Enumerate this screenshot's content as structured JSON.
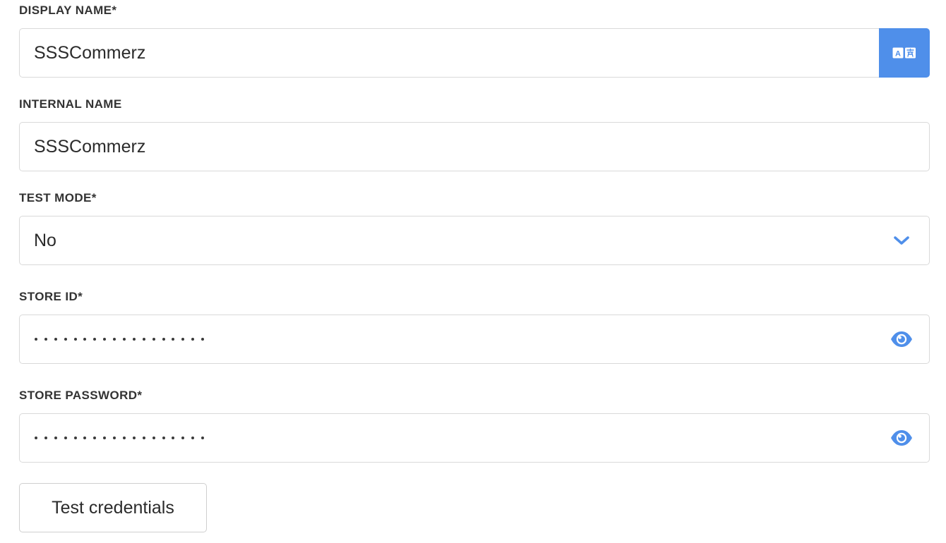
{
  "form": {
    "display_name": {
      "label": "DISPLAY NAME*",
      "value": "SSSCommerz",
      "translate_icon": "translate-icon"
    },
    "internal_name": {
      "label": "INTERNAL NAME",
      "value": "SSSCommerz"
    },
    "test_mode": {
      "label": "TEST MODE*",
      "selected": "No",
      "dropdown_icon": "chevron-down-icon"
    },
    "store_id": {
      "label": "STORE ID*",
      "masked_length": 18,
      "reveal_icon": "eye-icon"
    },
    "store_password": {
      "label": "STORE PASSWORD*",
      "masked_length": 18,
      "reveal_icon": "eye-icon"
    },
    "test_button_label": "Test credentials"
  },
  "colors": {
    "accent": "#4f8fea",
    "border": "#d9d9d9",
    "text": "#2b2b2b",
    "label": "#333333"
  }
}
